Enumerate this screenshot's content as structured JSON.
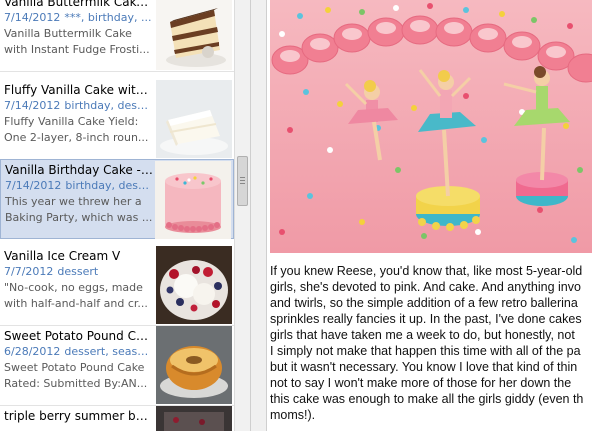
{
  "note_list": {
    "notes": [
      {
        "title": "Vanilla Buttermilk Cake ...",
        "date": "7/14/2012",
        "tags": "***, birthday, ...",
        "snippet_line1": "Vanilla Buttermilk Cake",
        "snippet_line2": "with Instant Fudge Frosti...",
        "thumb": "layer-cake-slice-thumbnail",
        "selected": false
      },
      {
        "title": "Fluffy Vanilla Cake with ...",
        "date": "7/14/2012",
        "tags": "birthday, dess...",
        "snippet_line1": "Fluffy Vanilla Cake Yield:",
        "snippet_line2": "One 2-layer, 8-inch roun...",
        "thumb": "white-cake-slice-thumbnail",
        "selected": false
      },
      {
        "title": "Vanilla Birthday Cake - S...",
        "date": "7/14/2012",
        "tags": "birthday, dess...",
        "snippet_line1": "This year we threw her a",
        "snippet_line2": "Baking Party, which was ...",
        "thumb": "pink-birthday-cake-thumbnail",
        "selected": true
      },
      {
        "title": "Vanilla Ice Cream V",
        "date": "7/7/2012",
        "tags": "dessert",
        "snippet_line1": "\"No-cook, no eggs, made",
        "snippet_line2": "with half-and-half and cr...",
        "thumb": "berries-ice-cream-thumbnail",
        "selected": false
      },
      {
        "title": "Sweet Potato Pound Cake",
        "date": "6/28/2012",
        "tags": "dessert, seaso...",
        "snippet_line1": "Sweet Potato Pound Cake",
        "snippet_line2": "Rated: Submitted By:AN...",
        "thumb": "bundt-cake-thumbnail",
        "selected": false
      },
      {
        "title": "triple berry summer butt...",
        "date": "",
        "tags": "",
        "snippet_line1": "",
        "snippet_line2": "",
        "thumb": "berry-dessert-thumbnail",
        "selected": false
      }
    ]
  },
  "editor": {
    "image": "pink-birthday-cake-with-ballerina-figurines",
    "body_lines": [
      "If you knew Reese, you'd know that, like most 5-year-old",
      "girls, she's devoted to pink. And cake. And anything invo",
      "and twirls, so the simple addition of a few retro ballerina",
      "sprinkles really fancies it up. In the past, I've done cakes",
      "girls that have taken me a week to do, but honestly, not",
      "I simply not make that happen this time with all of the pa",
      "but it wasn't necessary. You know I love that kind of thin",
      "not to say I won't make more of those for her down the",
      "this cake was enough to make all the girls giddy (even th",
      "moms!)."
    ]
  },
  "colors": {
    "selection_bg": "#d4deef",
    "tag_blue": "#4b7ab8",
    "frosting_pink": "#f2a4ad"
  }
}
